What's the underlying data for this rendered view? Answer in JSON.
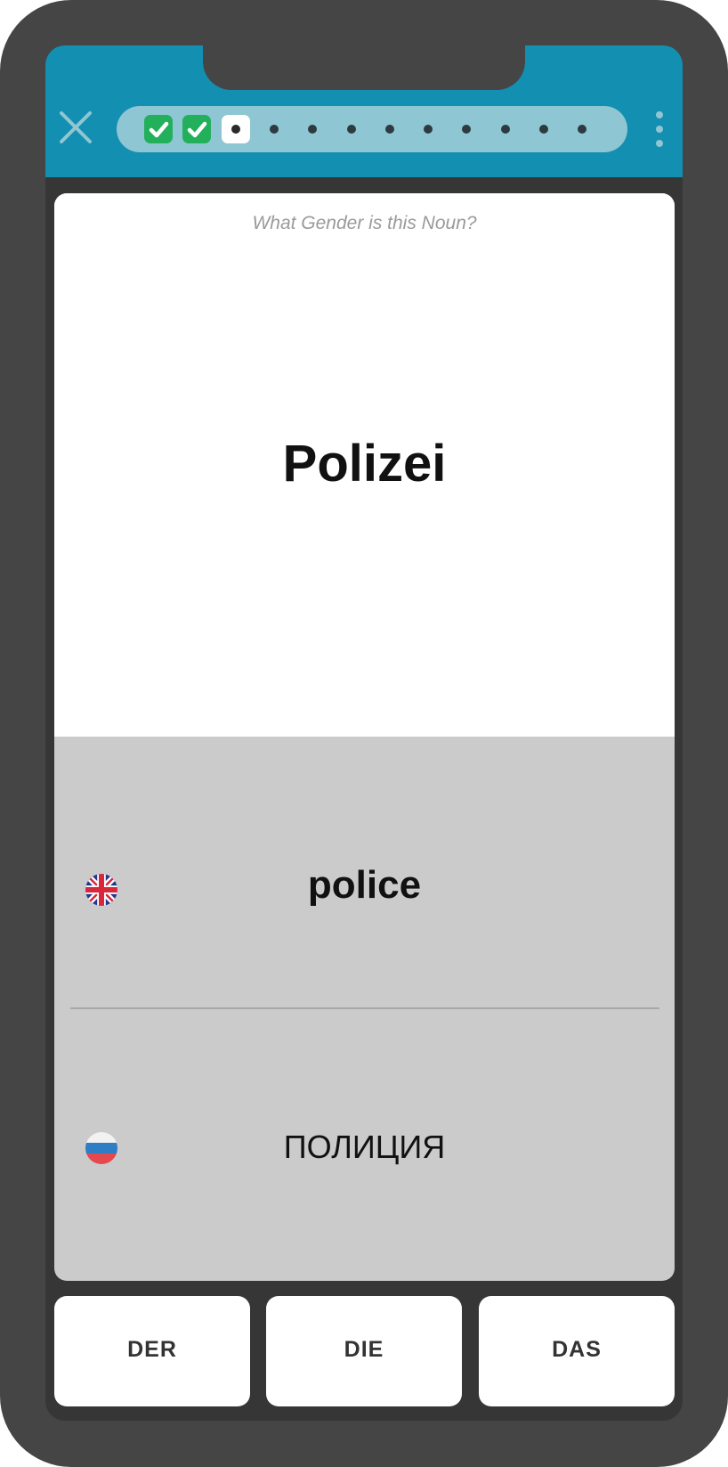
{
  "header": {
    "progress": [
      {
        "state": "done",
        "icon": "check-icon"
      },
      {
        "state": "done",
        "icon": "check-icon"
      },
      {
        "state": "current"
      },
      {
        "state": "todo"
      },
      {
        "state": "todo"
      },
      {
        "state": "todo"
      },
      {
        "state": "todo"
      },
      {
        "state": "todo"
      },
      {
        "state": "todo"
      },
      {
        "state": "todo"
      },
      {
        "state": "todo"
      },
      {
        "state": "todo"
      }
    ],
    "accent_color": "#128fb1",
    "done_color": "#22b05b"
  },
  "card": {
    "prompt": "What Gender is this Noun?",
    "word": "Polizei"
  },
  "translations": [
    {
      "language_icon": "uk-flag-icon",
      "text": "police"
    },
    {
      "language_icon": "russia-flag-icon",
      "text": "ПОЛИЦИЯ"
    }
  ],
  "answers": {
    "der": "DER",
    "die": "DIE",
    "das": "DAS"
  }
}
